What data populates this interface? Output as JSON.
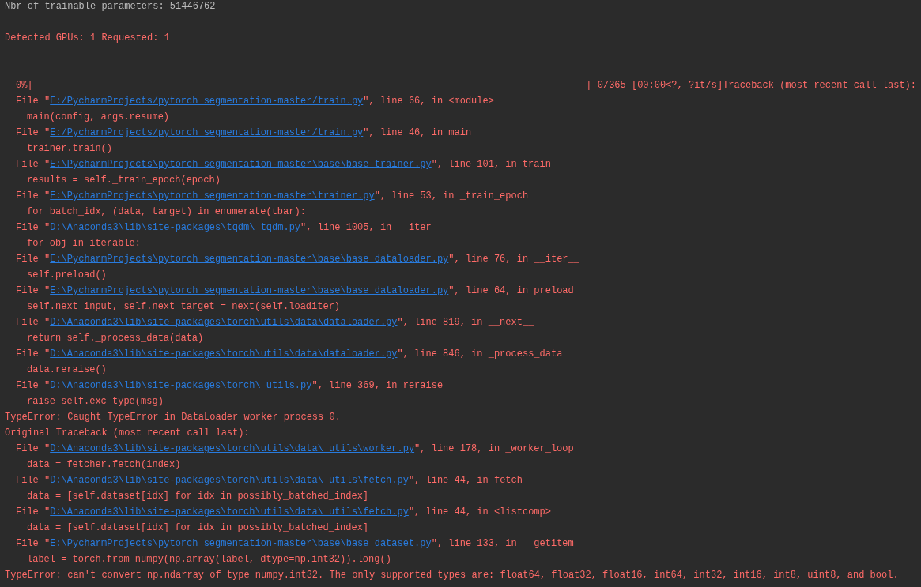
{
  "console": {
    "lines": [
      {
        "kind": "stdout",
        "text": "Nbr of trainable parameters: 51446762"
      },
      {
        "kind": "blank"
      },
      {
        "kind": "message",
        "text": "Detected GPUs: 1 Requested: 1"
      },
      {
        "kind": "blank"
      },
      {
        "kind": "blank"
      },
      {
        "kind": "progress",
        "percent": "0%|",
        "text": "| 0/365 [00:00<?, ?it/s]Traceback (most recent call last):"
      },
      {
        "kind": "frame",
        "prefix": "File \"",
        "path": "E:/PycharmProjects/pytorch_segmentation-master/train.py",
        "suffix": "\", line 66, in <module>"
      },
      {
        "kind": "source",
        "text": "main(config, args.resume)"
      },
      {
        "kind": "frame",
        "prefix": "File \"",
        "path": "E:/PycharmProjects/pytorch_segmentation-master/train.py",
        "suffix": "\", line 46, in main"
      },
      {
        "kind": "source",
        "text": "trainer.train()"
      },
      {
        "kind": "frame",
        "prefix": "File \"",
        "path": "E:\\PycharmProjects\\pytorch_segmentation-master\\base\\base_trainer.py",
        "suffix": "\", line 101, in train"
      },
      {
        "kind": "source",
        "text": "results = self._train_epoch(epoch)"
      },
      {
        "kind": "frame",
        "prefix": "File \"",
        "path": "E:\\PycharmProjects\\pytorch_segmentation-master\\trainer.py",
        "suffix": "\", line 53, in _train_epoch"
      },
      {
        "kind": "source",
        "text": "for batch_idx, (data, target) in enumerate(tbar):"
      },
      {
        "kind": "frame",
        "prefix": "File \"",
        "path": "D:\\Anaconda3\\lib\\site-packages\\tqdm\\_tqdm.py",
        "suffix": "\", line 1005, in __iter__"
      },
      {
        "kind": "source",
        "text": "for obj in iterable:"
      },
      {
        "kind": "frame",
        "prefix": "File \"",
        "path": "E:\\PycharmProjects\\pytorch_segmentation-master\\base\\base_dataloader.py",
        "suffix": "\", line 76, in __iter__"
      },
      {
        "kind": "source",
        "text": "self.preload()"
      },
      {
        "kind": "frame",
        "prefix": "File \"",
        "path": "E:\\PycharmProjects\\pytorch_segmentation-master\\base\\base_dataloader.py",
        "suffix": "\", line 64, in preload"
      },
      {
        "kind": "source",
        "text": "self.next_input, self.next_target = next(self.loaditer)"
      },
      {
        "kind": "frame",
        "prefix": "File \"",
        "path": "D:\\Anaconda3\\lib\\site-packages\\torch\\utils\\data\\dataloader.py",
        "suffix": "\", line 819, in __next__"
      },
      {
        "kind": "source",
        "text": "return self._process_data(data)"
      },
      {
        "kind": "frame",
        "prefix": "File \"",
        "path": "D:\\Anaconda3\\lib\\site-packages\\torch\\utils\\data\\dataloader.py",
        "suffix": "\", line 846, in _process_data"
      },
      {
        "kind": "source",
        "text": "data.reraise()"
      },
      {
        "kind": "frame",
        "prefix": "File \"",
        "path": "D:\\Anaconda3\\lib\\site-packages\\torch\\_utils.py",
        "suffix": "\", line 369, in reraise"
      },
      {
        "kind": "source",
        "text": "raise self.exc_type(msg)"
      },
      {
        "kind": "message",
        "text": "TypeError: Caught TypeError in DataLoader worker process 0."
      },
      {
        "kind": "message",
        "text": "Original Traceback (most recent call last):"
      },
      {
        "kind": "frame",
        "prefix": "File \"",
        "path": "D:\\Anaconda3\\lib\\site-packages\\torch\\utils\\data\\_utils\\worker.py",
        "suffix": "\", line 178, in _worker_loop"
      },
      {
        "kind": "source",
        "text": "data = fetcher.fetch(index)"
      },
      {
        "kind": "frame",
        "prefix": "File \"",
        "path": "D:\\Anaconda3\\lib\\site-packages\\torch\\utils\\data\\_utils\\fetch.py",
        "suffix": "\", line 44, in fetch"
      },
      {
        "kind": "source",
        "text": "data = [self.dataset[idx] for idx in possibly_batched_index]"
      },
      {
        "kind": "frame",
        "prefix": "File \"",
        "path": "D:\\Anaconda3\\lib\\site-packages\\torch\\utils\\data\\_utils\\fetch.py",
        "suffix": "\", line 44, in <listcomp>"
      },
      {
        "kind": "source",
        "text": "data = [self.dataset[idx] for idx in possibly_batched_index]"
      },
      {
        "kind": "frame",
        "prefix": "File \"",
        "path": "E:\\PycharmProjects\\pytorch_segmentation-master\\base\\base_dataset.py",
        "suffix": "\", line 133, in __getitem__"
      },
      {
        "kind": "source",
        "text": "label = torch.from_numpy(np.array(label, dtype=np.int32)).long()"
      },
      {
        "kind": "message",
        "text": "TypeError: can't convert np.ndarray of type numpy.int32. The only supported types are: float64, float32, float16, int64, int32, int16, int8, uint8, and bool."
      }
    ]
  }
}
